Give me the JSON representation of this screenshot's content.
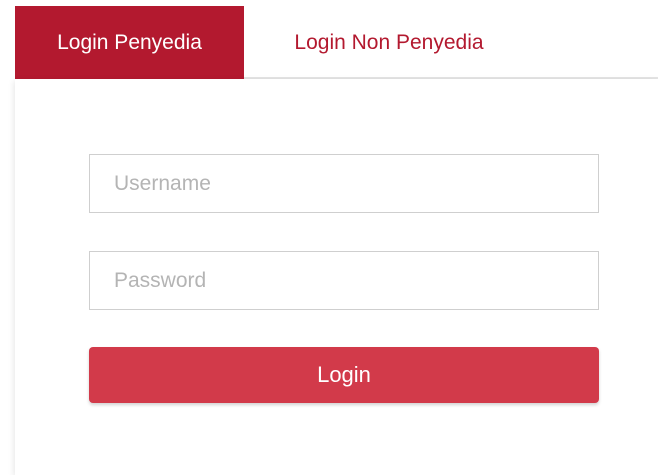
{
  "tabs": [
    {
      "label": "Login Penyedia",
      "active": true
    },
    {
      "label": "Login Non Penyedia",
      "active": false
    }
  ],
  "form": {
    "username_placeholder": "Username",
    "username_value": "",
    "password_placeholder": "Password",
    "password_value": "",
    "login_label": "Login"
  },
  "colors": {
    "active_tab": "#b3192f",
    "inactive_tab_text": "#b3192f",
    "button": "#d23a4a",
    "field_border": "#cfcfcf",
    "placeholder": "#b4b4b4"
  }
}
